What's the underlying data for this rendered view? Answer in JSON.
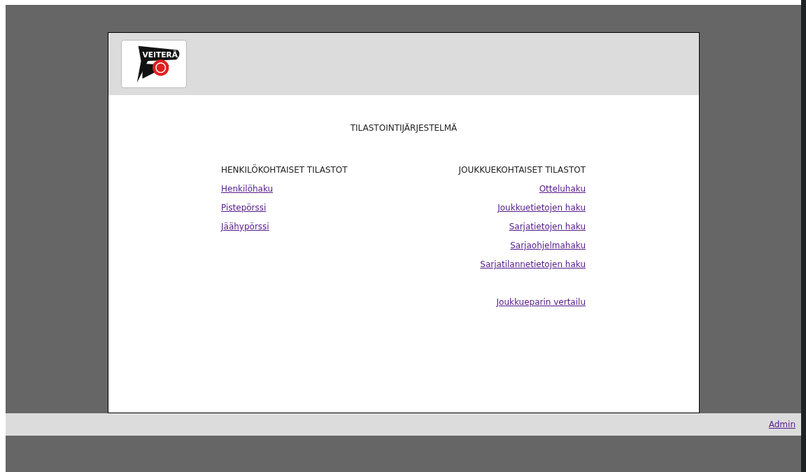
{
  "header": {
    "logo_text": "VEITERÄ"
  },
  "title": "TILASTOINTIJÄRJESTELMÄ",
  "left_column": {
    "heading": "HENKILÖKOHTAISET TILASTOT",
    "link_groups": [
      [
        "Henkilöhaku",
        "Pistepörssi",
        "Jäähypörssi"
      ]
    ]
  },
  "right_column": {
    "heading": "JOUKKUEKOHTAISET TILASTOT",
    "link_groups": [
      [
        "Otteluhaku",
        "Joukkuetietojen haku",
        "Sarjatietojen haku",
        "Sarjaohjelmahaku",
        "Sarjatilannetietojen haku"
      ],
      [
        "Joukkueparin vertailu"
      ]
    ]
  },
  "footer": {
    "link": "Admin"
  }
}
